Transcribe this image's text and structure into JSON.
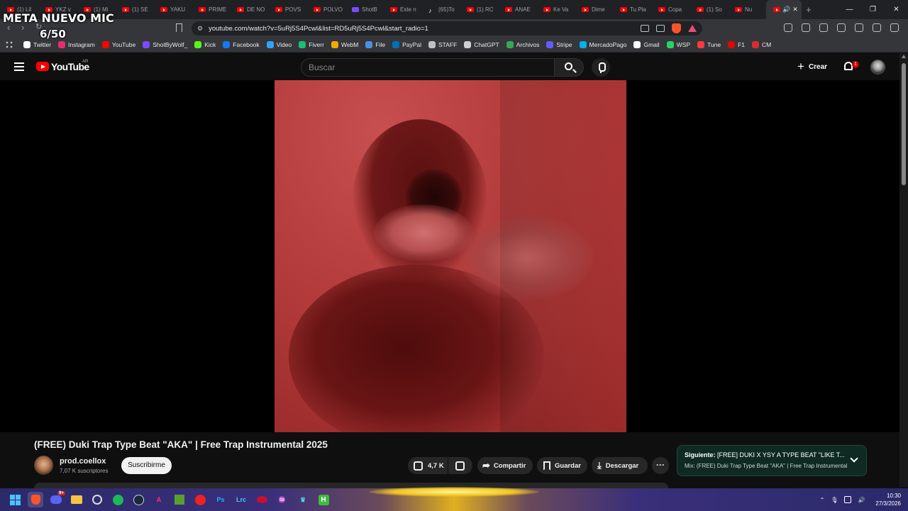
{
  "overlay": {
    "title": "META NUEVO MIC",
    "count": "6/50"
  },
  "browser": {
    "tabs": [
      {
        "label": "(1) Lil",
        "icon": "youtube-icon"
      },
      {
        "label": "YKZ v",
        "icon": "youtube-icon"
      },
      {
        "label": "(1) Mi",
        "icon": "youtube-icon"
      },
      {
        "label": "(1) SE",
        "icon": "youtube-icon"
      },
      {
        "label": "YAKU",
        "icon": "youtube-icon"
      },
      {
        "label": "PRIME",
        "icon": "youtube-icon"
      },
      {
        "label": "DE NO",
        "icon": "youtube-icon"
      },
      {
        "label": "POVS",
        "icon": "youtube-icon"
      },
      {
        "label": "POLVO",
        "icon": "youtube-icon"
      },
      {
        "label": "ShotB",
        "icon": "shotbywolf-icon"
      },
      {
        "label": "Este n",
        "icon": "youtube-icon"
      },
      {
        "label": "(65)To",
        "icon": "tiktok-icon"
      },
      {
        "label": "(1) RC",
        "icon": "youtube-icon"
      },
      {
        "label": "ANAE",
        "icon": "youtube-icon"
      },
      {
        "label": "Ke Va",
        "icon": "youtube-icon"
      },
      {
        "label": "Dime",
        "icon": "youtube-icon"
      },
      {
        "label": "Tu Pla",
        "icon": "youtube-icon"
      },
      {
        "label": "Copa",
        "icon": "youtube-icon"
      },
      {
        "label": "(1) So",
        "icon": "youtube-icon"
      },
      {
        "label": "Nu",
        "icon": "youtube-icon"
      }
    ],
    "url": "youtube.com/watch?v=5uRj5S4Pcwl&list=RD5uRj5S4Pcwl&start_radio=1",
    "bookmarks": [
      {
        "label": "Twitter",
        "color": "#ffffff"
      },
      {
        "label": "Instagram",
        "color": "#e1306c"
      },
      {
        "label": "YouTube",
        "color": "#ff0000"
      },
      {
        "label": "ShotByWolf_",
        "color": "#7a4cff"
      },
      {
        "label": "Kick",
        "color": "#53fc18"
      },
      {
        "label": "Facebook",
        "color": "#1877f2"
      },
      {
        "label": "Video",
        "color": "#2fa4ff"
      },
      {
        "label": "Fiverr",
        "color": "#1dbf73"
      },
      {
        "label": "WebM",
        "color": "#f2a900"
      },
      {
        "label": "File",
        "color": "#4a90e2"
      },
      {
        "label": "PayPal",
        "color": "#0070ba"
      },
      {
        "label": "STAFF",
        "color": "#bdc1c6"
      },
      {
        "label": "ChatGPT",
        "color": "#d0d0d0"
      },
      {
        "label": "Archivos",
        "color": "#34a853"
      },
      {
        "label": "Stripe",
        "color": "#635bff"
      },
      {
        "label": "MercadoPago",
        "color": "#00b1ea"
      },
      {
        "label": "Gmail",
        "color": "#ffffff"
      },
      {
        "label": "WSP",
        "color": "#25d366"
      },
      {
        "label": "Tune",
        "color": "#ff3b3b"
      },
      {
        "label": "F1",
        "color": "#e10600"
      },
      {
        "label": "CM",
        "color": "#d62d2d"
      }
    ]
  },
  "youtube": {
    "logo_text": "YouTube",
    "country": "AR",
    "search_placeholder": "Buscar",
    "create_label": "Crear",
    "notifications_count": "1",
    "video_title": "(FREE) Duki Trap Type Beat \"AKA\" | Free Trap Instrumental 2025",
    "channel_name": "prod.coellox",
    "subscribers": "7,07 K suscriptores",
    "subscribe_label": "Suscribirme",
    "likes": "4,7 K",
    "share_label": "Compartir",
    "save_label": "Guardar",
    "download_label": "Descargar",
    "next_prefix": "Siguiente:",
    "next_title": "[FREE] DUKI X YSY A TYPE BEAT \"LIKE T...",
    "mix_title": "Mix: (FREE) Duki Trap Type Beat \"AKA\" | Free Trap Instrumental"
  },
  "taskbar": {
    "discord_badge": "9+",
    "clock_time": "10:30",
    "clock_date": "27/3/2026"
  }
}
